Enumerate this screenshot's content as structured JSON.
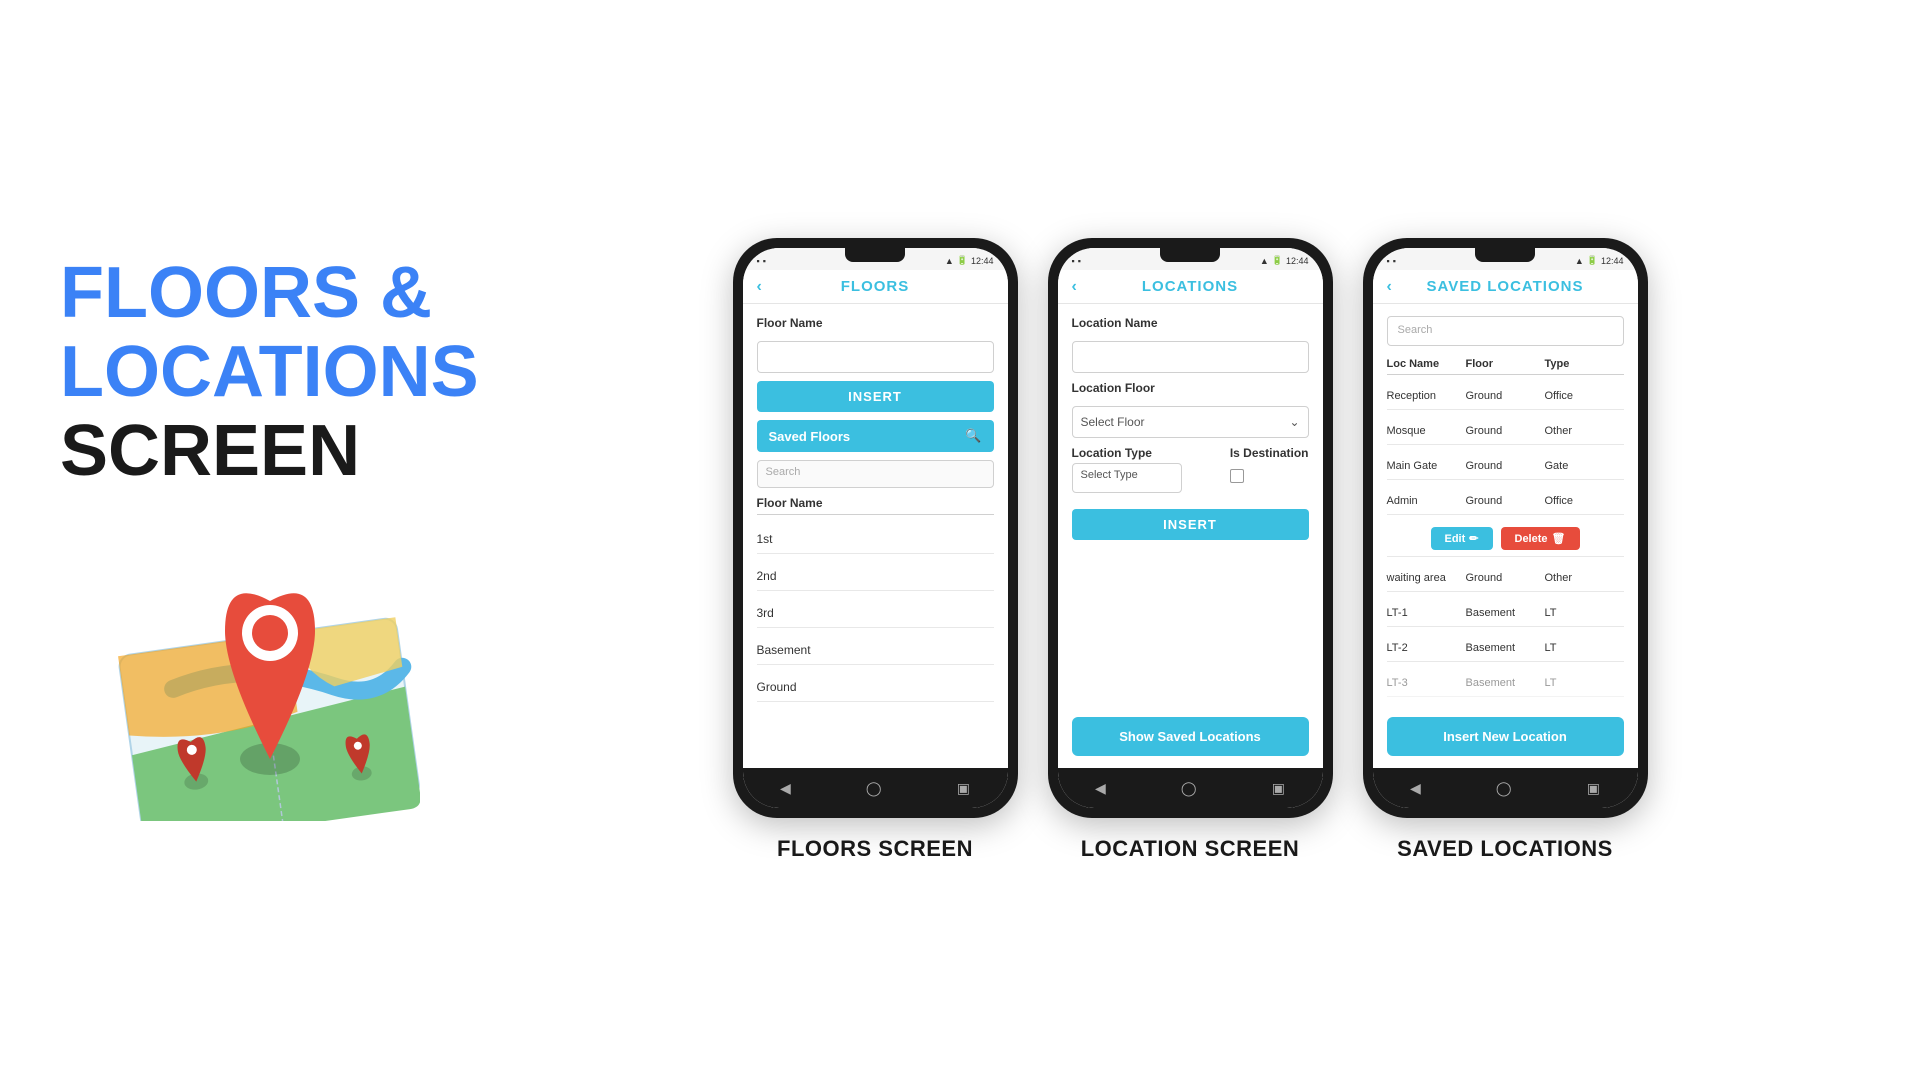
{
  "left": {
    "title_line1": "FLOORS &",
    "title_line2": "LOCATIONS",
    "title_line3": "SCREEN"
  },
  "phones": [
    {
      "id": "floors",
      "label": "FLOORS SCREEN",
      "header": "FLOORS",
      "status_time": "12:44",
      "floor_name_label": "Floor Name",
      "insert_btn": "INSERT",
      "saved_floors_btn": "Saved Floors",
      "search_placeholder": "Search",
      "floors_table_label": "Floor Name",
      "floors": [
        "1st",
        "2nd",
        "3rd",
        "Basement",
        "Ground"
      ]
    },
    {
      "id": "locations",
      "label": "LOCATION SCREEN",
      "header": "LOCATIONS",
      "status_time": "12:44",
      "location_name_label": "Location Name",
      "location_floor_label": "Location Floor",
      "select_floor_placeholder": "Select Floor",
      "location_type_label": "Location Type",
      "is_destination_label": "Is Destination",
      "select_type_placeholder": "Select Type",
      "insert_btn": "INSERT",
      "show_saved_btn": "Show Saved Locations"
    },
    {
      "id": "saved",
      "label": "SAVED LOCATIONS",
      "header": "SAVED LOCATIONS",
      "status_time": "12:44",
      "search_placeholder": "Search",
      "col_loc_name": "Loc Name",
      "col_floor": "Floor",
      "col_type": "Type",
      "rows": [
        {
          "name": "Reception",
          "floor": "Ground",
          "type": "Office"
        },
        {
          "name": "Mosque",
          "floor": "Ground",
          "type": "Other"
        },
        {
          "name": "Main Gate",
          "floor": "Ground",
          "type": "Gate"
        },
        {
          "name": "Admin",
          "floor": "Ground",
          "type": "Office"
        }
      ],
      "edit_btn": "Edit",
      "delete_btn": "Delete",
      "extra_rows": [
        {
          "name": "waiting area",
          "floor": "Ground",
          "type": "Other"
        },
        {
          "name": "LT-1",
          "floor": "Basement",
          "type": "LT"
        },
        {
          "name": "LT-2",
          "floor": "Basement",
          "type": "LT"
        },
        {
          "name": "LT-3",
          "floor": "Basement",
          "type": "LT"
        }
      ],
      "insert_new_btn": "Insert New Location"
    }
  ],
  "colors": {
    "accent": "#3bbfe0",
    "blue_title": "#3b82f6",
    "delete_red": "#e74c3c"
  }
}
